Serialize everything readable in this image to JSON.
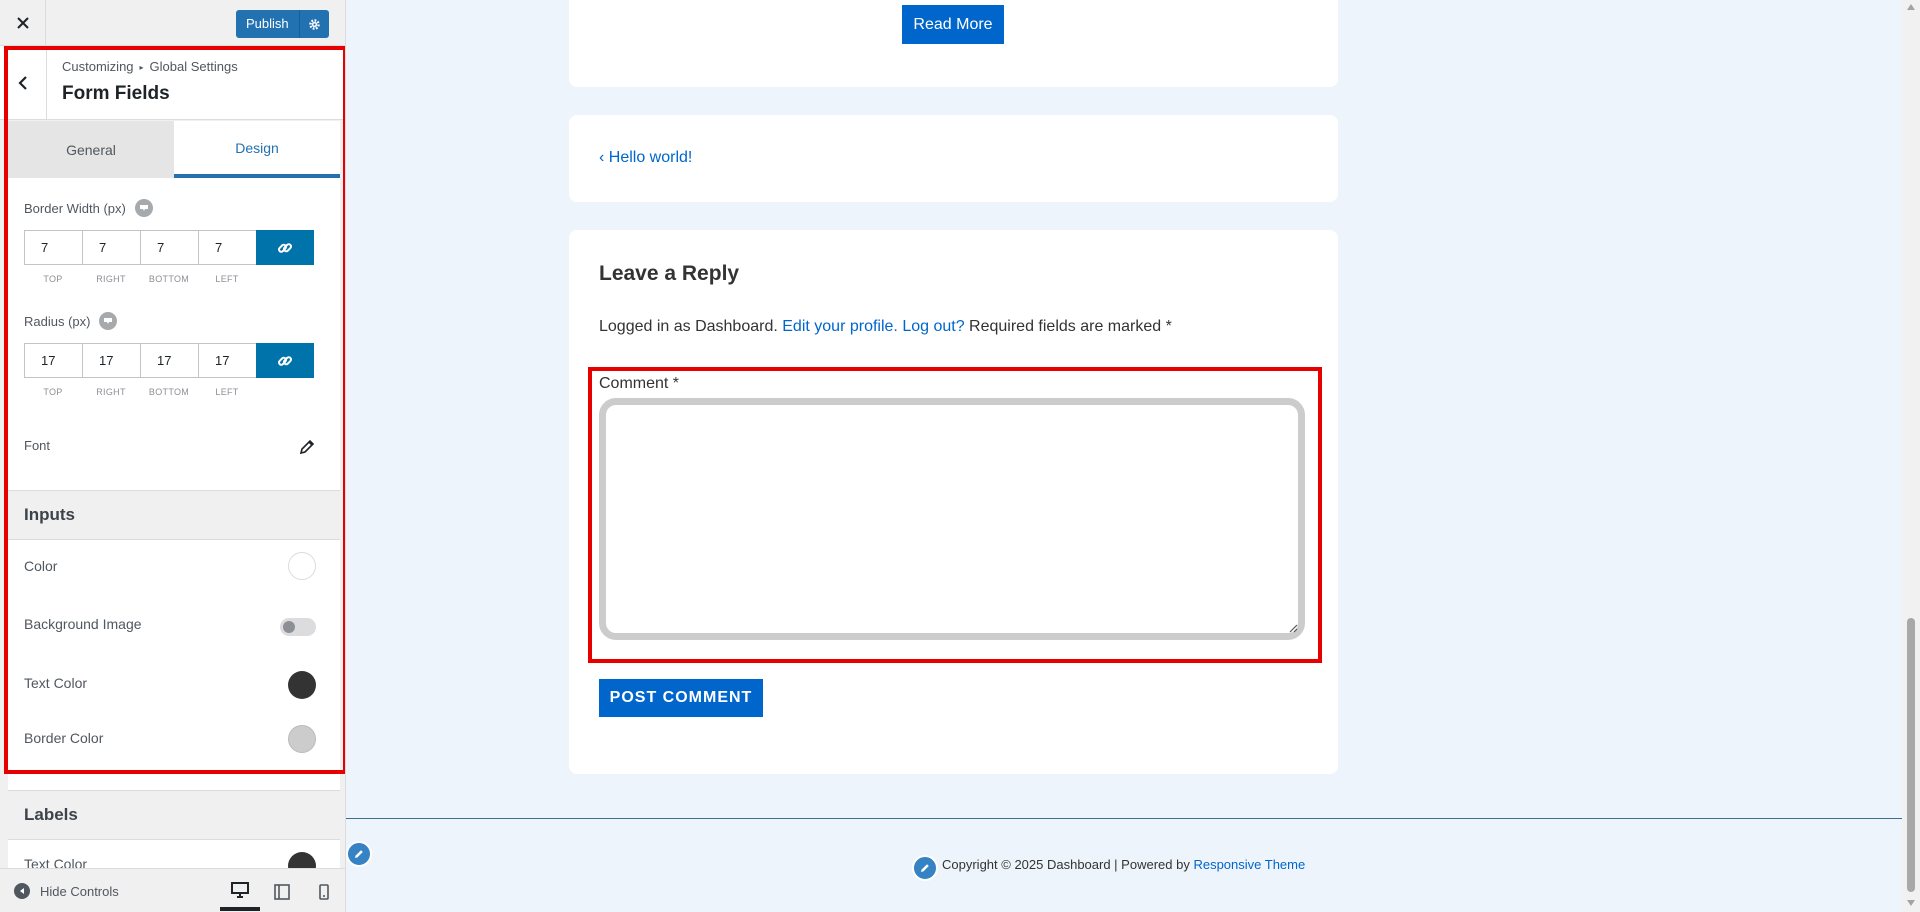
{
  "header": {
    "publish_label": "Publish"
  },
  "section": {
    "breadcrumb_root": "Customizing",
    "breadcrumb_parent": "Global Settings",
    "title": "Form Fields"
  },
  "tabs": [
    {
      "label": "General",
      "active": false
    },
    {
      "label": "Design",
      "active": true
    }
  ],
  "border_width": {
    "label": "Border Width (px)",
    "values": {
      "top": "7",
      "right": "7",
      "bottom": "7",
      "left": "7"
    },
    "captions": [
      "TOP",
      "RIGHT",
      "BOTTOM",
      "LEFT"
    ]
  },
  "radius": {
    "label": "Radius (px)",
    "values": {
      "top": "17",
      "right": "17",
      "bottom": "17",
      "left": "17"
    },
    "captions": [
      "TOP",
      "RIGHT",
      "BOTTOM",
      "LEFT"
    ]
  },
  "font_label": "Font",
  "inputs": {
    "heading": "Inputs",
    "color_label": "Color",
    "color_value": "#ffffff",
    "bg_image_label": "Background Image",
    "bg_image_enabled": false,
    "text_color_label": "Text Color",
    "text_color_value": "#333333",
    "border_color_label": "Border Color",
    "border_color_value": "#cccccc"
  },
  "labels_group": {
    "heading": "Labels",
    "text_color_label": "Text Color",
    "text_color_value": "#333333"
  },
  "footer": {
    "hide_controls_label": "Hide Controls"
  },
  "preview": {
    "read_more_label": "Read More",
    "prev_post_label": "‹ Hello world!",
    "reply_title": "Leave a Reply",
    "logged_in_prefix": "Logged in as Dashboard.",
    "edit_profile_label": "Edit your profile.",
    "logout_label": "Log out?",
    "required_text": "Required fields are marked *",
    "comment_label": "Comment *",
    "comment_value": "",
    "post_comment_label": "POST COMMENT",
    "copyright_text": "Copyright © 2025 Dashboard | Powered by",
    "theme_link_label": "Responsive Theme"
  },
  "colors": {
    "accent": "#0066cc",
    "wp_blue": "#2271b1",
    "highlight": "#e60000"
  }
}
